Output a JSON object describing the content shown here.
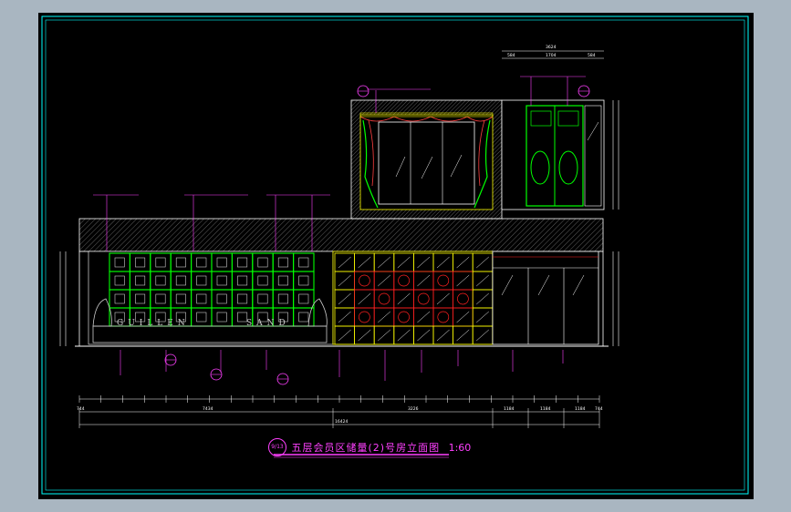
{
  "colors": {
    "background": "#a9b6c1",
    "viewport": "#000000",
    "frame": "#00ffff",
    "annotation": "#ff40ff",
    "outline": "#ffffff",
    "panel": "#00ff00",
    "wine_cabinet": "#ffff00",
    "grid_accent": "#ff2020",
    "curtain": "#ff4040",
    "glass": "#0000ff",
    "dimension": "#ffffff"
  },
  "drawing": {
    "title_tag": "9/13",
    "title": "五层会员区储量(2)号房立面图",
    "scale": "1:60",
    "panel_lettering": [
      "GUILLEN",
      "SAND"
    ],
    "dimensions": {
      "top_right": [
        "3624",
        "584",
        "1704",
        "584"
      ],
      "bottom_total": "16424",
      "bottom_left": "7434",
      "bottom_mid": "3226",
      "bottom_right": [
        "1184",
        "1184",
        "1184"
      ],
      "edge": "744"
    },
    "icons": [
      "section-marker-icon",
      "detail-callout-icon"
    ]
  }
}
